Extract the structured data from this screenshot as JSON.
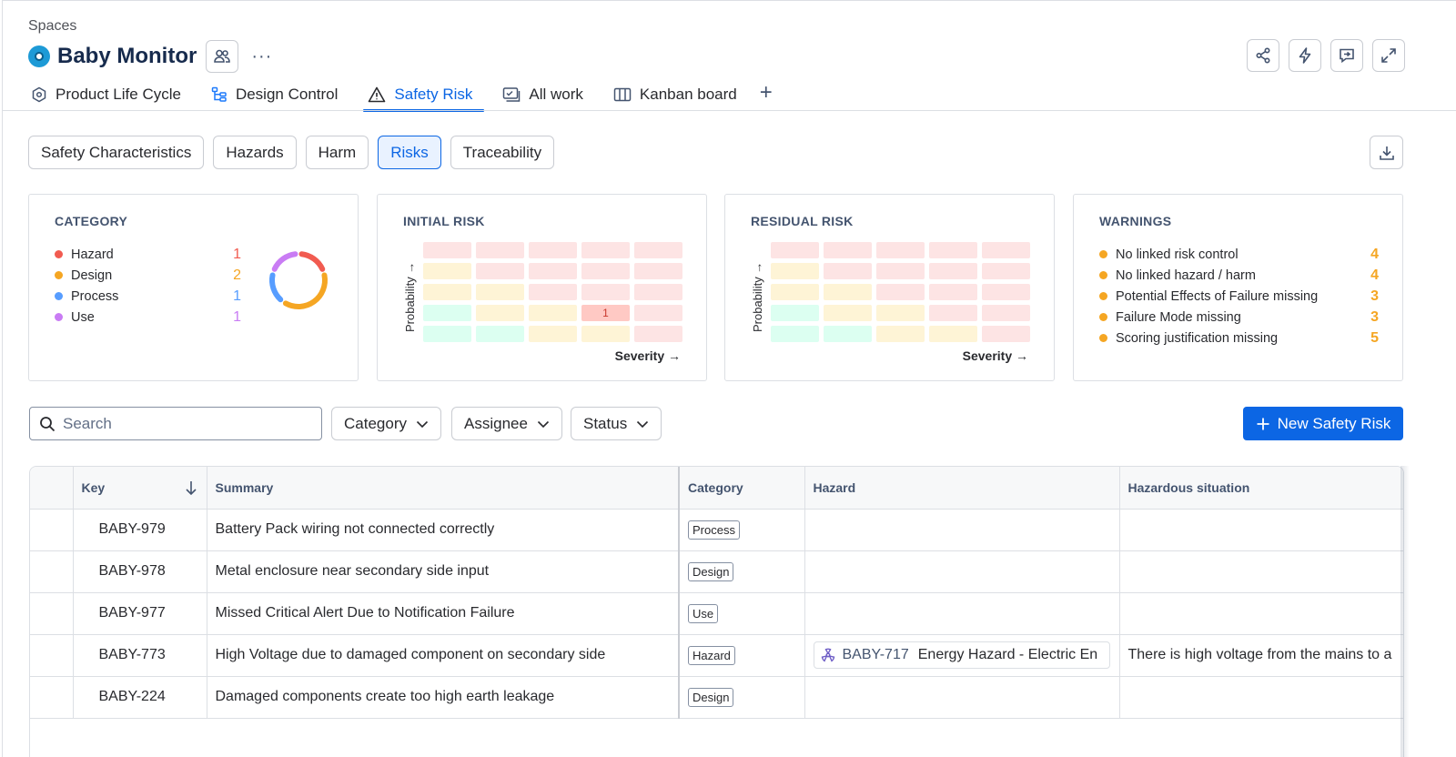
{
  "header": {
    "breadcrumb": "Spaces",
    "space_title": "Baby Monitor",
    "more": "···"
  },
  "tabs": [
    {
      "label": "Product Life Cycle",
      "icon": "hexagon-icon"
    },
    {
      "label": "Design Control",
      "icon": "hierarchy-icon"
    },
    {
      "label": "Safety Risk",
      "icon": "warning-icon",
      "active": true
    },
    {
      "label": "All work",
      "icon": "list-check-icon"
    },
    {
      "label": "Kanban board",
      "icon": "board-icon"
    }
  ],
  "subtabs": [
    {
      "label": "Safety Characteristics"
    },
    {
      "label": "Hazards"
    },
    {
      "label": "Harm"
    },
    {
      "label": "Risks",
      "active": true
    },
    {
      "label": "Traceability"
    }
  ],
  "cards": {
    "category": {
      "title": "CATEGORY",
      "items": [
        {
          "label": "Hazard",
          "count": "1",
          "color": "#f15b50"
        },
        {
          "label": "Design",
          "count": "2",
          "color": "#f5a623"
        },
        {
          "label": "Process",
          "count": "1",
          "color": "#579dff"
        },
        {
          "label": "Use",
          "count": "1",
          "color": "#c97cf4"
        }
      ]
    },
    "initial_risk": {
      "title": "INITIAL RISK",
      "y_label": "Probability →",
      "x_label": "Severity →",
      "cell_value": "1"
    },
    "residual_risk": {
      "title": "RESIDUAL RISK",
      "y_label": "Probability →",
      "x_label": "Severity →"
    },
    "warnings": {
      "title": "WARNINGS",
      "items": [
        {
          "label": "No linked risk control",
          "count": "4"
        },
        {
          "label": "No linked hazard / harm",
          "count": "4"
        },
        {
          "label": "Potential Effects of Failure missing",
          "count": "3"
        },
        {
          "label": "Failure Mode missing",
          "count": "3"
        },
        {
          "label": "Scoring justification missing",
          "count": "5"
        }
      ]
    }
  },
  "filters": {
    "search_placeholder": "Search",
    "category": "Category",
    "assignee": "Assignee",
    "status": "Status",
    "new_button": "New Safety Risk"
  },
  "table": {
    "headers": {
      "key": "Key",
      "summary": "Summary",
      "category": "Category",
      "hazard": "Hazard",
      "hazardous_situation": "Hazardous situation"
    },
    "rows": [
      {
        "key": "BABY-979",
        "summary": "Battery Pack wiring not connected correctly",
        "category": "Process",
        "hazard_key": "",
        "hazard_title": "",
        "situation": ""
      },
      {
        "key": "BABY-978",
        "summary": "Metal enclosure near secondary side input",
        "category": "Design",
        "hazard_key": "",
        "hazard_title": "",
        "situation": ""
      },
      {
        "key": "BABY-977",
        "summary": "Missed Critical Alert Due to Notification Failure",
        "category": "Use",
        "hazard_key": "",
        "hazard_title": "",
        "situation": ""
      },
      {
        "key": "BABY-773",
        "summary": "High Voltage due to damaged component on secondary side",
        "category": "Hazard",
        "hazard_key": "BABY-717",
        "hazard_title": "Energy Hazard - Electric En",
        "situation": "There is high voltage from the mains to a"
      },
      {
        "key": "BABY-224",
        "summary": "Damaged components create too high earth leakage",
        "category": "Design",
        "hazard_key": "",
        "hazard_title": "",
        "situation": ""
      }
    ]
  },
  "colors": {
    "accent": "#0c66e4",
    "risk_red": "#fde4e4",
    "risk_yellow": "#fef4d6",
    "risk_green": "#dcfff1",
    "risk_highlight": "#ffc9c4",
    "warning_count": "#f5a623"
  }
}
